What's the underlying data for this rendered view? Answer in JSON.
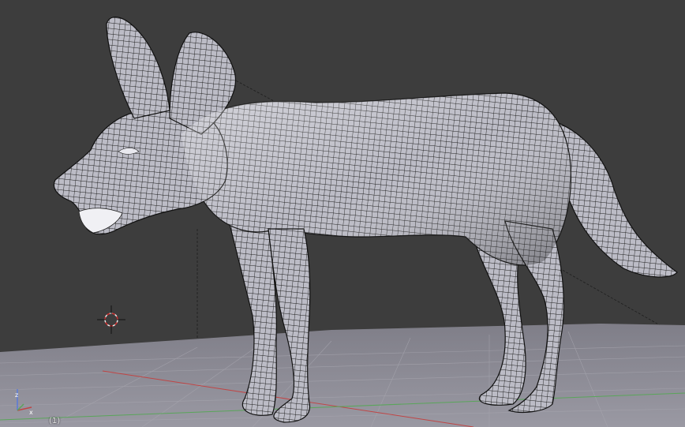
{
  "viewport": {
    "frame_label": "(1)",
    "background_color": "#3d3d3d",
    "floor_color": "#8b8a93",
    "grid_line_color": "#9b9ba4",
    "x_axis_color": "#c04040",
    "y_axis_color": "#50a050",
    "mesh_fill_color": "#b8b8c0",
    "wire_color": "#1a1a1a"
  },
  "scene": {
    "object": "wolf-mesh",
    "shading": "wireframe-on-solid",
    "cursor": "3d-cursor-icon",
    "axis_gizmo": "axis-gizmo-icon"
  }
}
